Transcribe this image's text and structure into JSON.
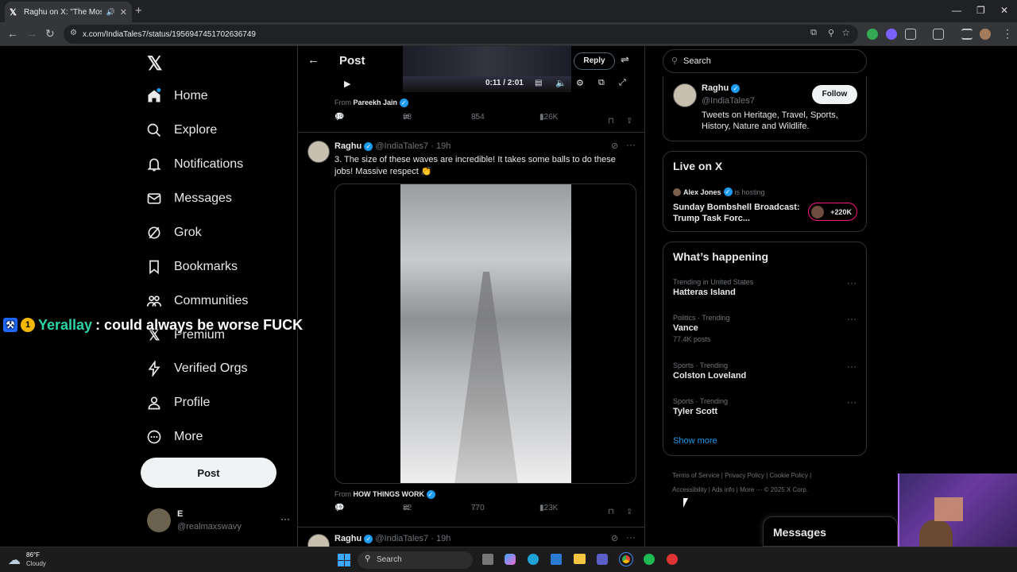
{
  "browser": {
    "tab_title": "Raghu on X: \"The Most Da",
    "url": "x.com/IndiaTales7/status/1956947451702636749"
  },
  "nav": {
    "items": [
      {
        "label": "Home"
      },
      {
        "label": "Explore"
      },
      {
        "label": "Notifications"
      },
      {
        "label": "Messages"
      },
      {
        "label": "Grok"
      },
      {
        "label": "Bookmarks"
      },
      {
        "label": "Communities"
      },
      {
        "label": "Premium"
      },
      {
        "label": "Verified Orgs"
      },
      {
        "label": "Profile"
      },
      {
        "label": "More"
      }
    ],
    "post_label": "Post",
    "account_name": "E",
    "account_handle": "@realmaxswavy"
  },
  "overlay": {
    "chat_user": "Yerallay",
    "chat_message": ": could always be worse FUCK",
    "badge_number": "1"
  },
  "header": {
    "title": "Post",
    "reply_label": "Reply"
  },
  "video1": {
    "time": "0:11 / 2:01",
    "from_label": "From",
    "from_name": "Pareekh Jain",
    "replies": "13",
    "reposts": "98",
    "likes": "854",
    "views": "126K"
  },
  "tweet2": {
    "name": "Raghu",
    "handle": "@IndiaTales7",
    "time": "· 19h",
    "text": "3. The size of these waves are incredible!  It takes some balls to do these jobs! Massive respect 👏",
    "from_label": "From",
    "from_name": "HOW THINGS WORK",
    "replies": "11",
    "reposts": "82",
    "likes": "770",
    "views": "123K"
  },
  "tweet3": {
    "name": "Raghu",
    "handle": "@IndiaTales7",
    "time": "· 19h"
  },
  "search": {
    "placeholder": "Search"
  },
  "profile_card": {
    "name": "Raghu",
    "handle": "@IndiaTales7",
    "follow_label": "Follow",
    "bio": "Tweets on Heritage, Travel, Sports, History, Nature and Wildlife."
  },
  "live": {
    "heading": "Live on X",
    "host": "Alex Jones",
    "hosting": "is hosting",
    "title": "Sunday Bombshell Broadcast: Trump Task Forc...",
    "count": "+220K"
  },
  "happening": {
    "heading": "What’s happening",
    "trends": [
      {
        "meta": "Trending in United States",
        "title": "Hatteras Island",
        "posts": ""
      },
      {
        "meta": "Politics · Trending",
        "title": "Vance",
        "posts": "77.4K posts"
      },
      {
        "meta": "Sports · Trending",
        "title": "Colston Loveland",
        "posts": ""
      },
      {
        "meta": "Sports · Trending",
        "title": "Tyler Scott",
        "posts": ""
      }
    ],
    "show_more": "Show more"
  },
  "footer": {
    "terms": "Terms of Service",
    "privacy": "Privacy Policy",
    "cookie": "Cookie Policy",
    "accessibility": "Accessibility",
    "ads": "Ads info",
    "more": "More ···",
    "copyright": "© 2025 X Corp."
  },
  "messages_drawer": {
    "label": "Messages"
  },
  "taskbar": {
    "weather_temp": "86°F",
    "weather_desc": "Cloudy",
    "search_label": "Search"
  },
  "colors": {
    "accent": "#1d9bf0",
    "chat_user": "#2ed3a8",
    "live_pink": "#f91880"
  }
}
